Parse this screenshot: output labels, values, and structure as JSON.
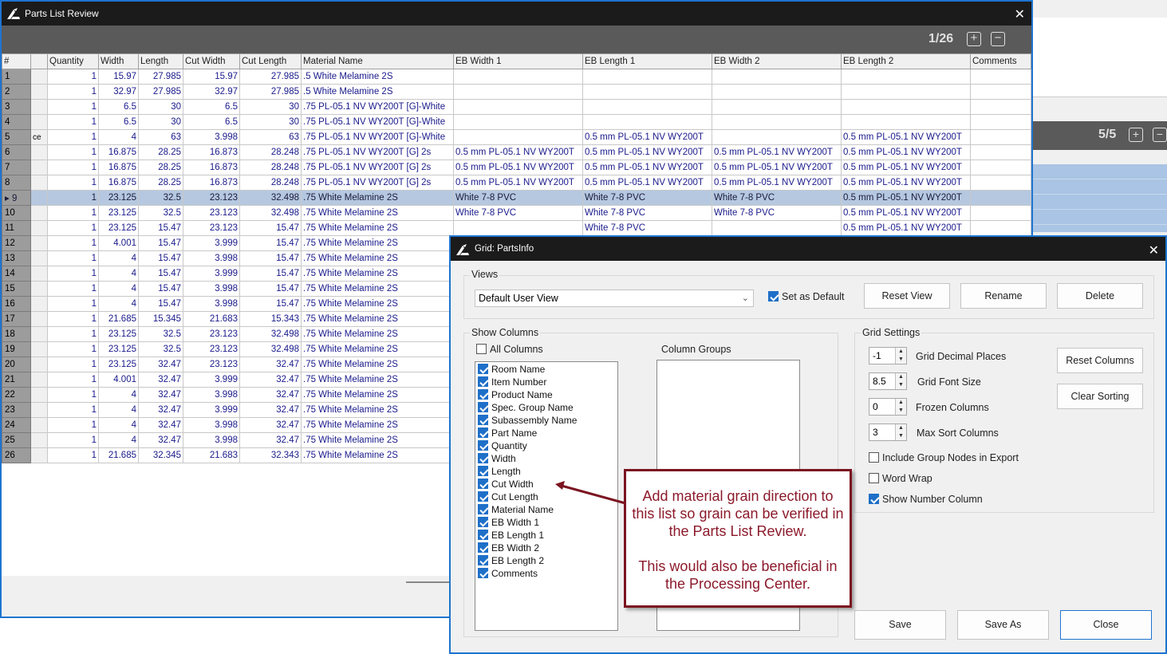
{
  "background_window": {
    "count": "5/5",
    "plus_label": "+",
    "minus_label": "−"
  },
  "parts_list_review": {
    "title": "Parts List Review",
    "close_label": "✕",
    "page_count": "1/26",
    "plus_label": "+",
    "minus_label": "−",
    "columns": [
      "#",
      "",
      "Quantity",
      "Width",
      "Length",
      "Cut Width",
      "Cut Length",
      "Material Name",
      "EB Width 1",
      "EB Length 1",
      "EB Width 2",
      "EB Length 2",
      "Comments"
    ],
    "selected_row": "9",
    "rows": [
      [
        "1",
        "",
        "1",
        "15.97",
        "27.985",
        "15.97",
        "27.985",
        ".5 White Melamine 2S",
        "",
        "",
        "",
        "",
        ""
      ],
      [
        "2",
        "",
        "1",
        "32.97",
        "27.985",
        "32.97",
        "27.985",
        ".5 White Melamine 2S",
        "",
        "",
        "",
        "",
        ""
      ],
      [
        "3",
        "",
        "1",
        "6.5",
        "30",
        "6.5",
        "30",
        ".75 PL-05.1 NV WY200T [G]-White",
        "",
        "",
        "",
        "",
        ""
      ],
      [
        "4",
        "",
        "1",
        "6.5",
        "30",
        "6.5",
        "30",
        ".75 PL-05.1 NV WY200T [G]-White",
        "",
        "",
        "",
        "",
        ""
      ],
      [
        "5",
        "ce",
        "1",
        "4",
        "63",
        "3.998",
        "63",
        ".75 PL-05.1 NV WY200T [G]-White",
        "",
        "0.5 mm PL-05.1 NV WY200T",
        "",
        "0.5 mm PL-05.1 NV WY200T",
        ""
      ],
      [
        "6",
        "",
        "1",
        "16.875",
        "28.25",
        "16.873",
        "28.248",
        ".75 PL-05.1 NV WY200T [G] 2s",
        "0.5 mm PL-05.1 NV WY200T",
        "0.5 mm PL-05.1 NV WY200T",
        "0.5 mm PL-05.1 NV WY200T",
        "0.5 mm PL-05.1 NV WY200T",
        ""
      ],
      [
        "7",
        "",
        "1",
        "16.875",
        "28.25",
        "16.873",
        "28.248",
        ".75 PL-05.1 NV WY200T [G] 2s",
        "0.5 mm PL-05.1 NV WY200T",
        "0.5 mm PL-05.1 NV WY200T",
        "0.5 mm PL-05.1 NV WY200T",
        "0.5 mm PL-05.1 NV WY200T",
        ""
      ],
      [
        "8",
        "",
        "1",
        "16.875",
        "28.25",
        "16.873",
        "28.248",
        ".75 PL-05.1 NV WY200T [G] 2s",
        "0.5 mm PL-05.1 NV WY200T",
        "0.5 mm PL-05.1 NV WY200T",
        "0.5 mm PL-05.1 NV WY200T",
        "0.5 mm PL-05.1 NV WY200T",
        ""
      ],
      [
        "9",
        "",
        "1",
        "23.125",
        "32.5",
        "23.123",
        "32.498",
        ".75 White Melamine 2S",
        "White 7-8 PVC",
        "White 7-8 PVC",
        "White 7-8 PVC",
        "0.5 mm PL-05.1 NV WY200T",
        ""
      ],
      [
        "10",
        "",
        "1",
        "23.125",
        "32.5",
        "23.123",
        "32.498",
        ".75 White Melamine 2S",
        "White 7-8 PVC",
        "White 7-8 PVC",
        "White 7-8 PVC",
        "0.5 mm PL-05.1 NV WY200T",
        ""
      ],
      [
        "11",
        "",
        "1",
        "23.125",
        "15.47",
        "23.123",
        "15.47",
        ".75 White Melamine 2S",
        "",
        "White 7-8 PVC",
        "",
        "0.5 mm PL-05.1 NV WY200T",
        ""
      ],
      [
        "12",
        "",
        "1",
        "4.001",
        "15.47",
        "3.999",
        "15.47",
        ".75 White Melamine 2S",
        "",
        "",
        "",
        "",
        ""
      ],
      [
        "13",
        "",
        "1",
        "4",
        "15.47",
        "3.998",
        "15.47",
        ".75 White Melamine 2S",
        "",
        "",
        "",
        "",
        ""
      ],
      [
        "14",
        "",
        "1",
        "4",
        "15.47",
        "3.999",
        "15.47",
        ".75 White Melamine 2S",
        "",
        "",
        "",
        "",
        ""
      ],
      [
        "15",
        "",
        "1",
        "4",
        "15.47",
        "3.998",
        "15.47",
        ".75 White Melamine 2S",
        "",
        "",
        "",
        "",
        ""
      ],
      [
        "16",
        "",
        "1",
        "4",
        "15.47",
        "3.998",
        "15.47",
        ".75 White Melamine 2S",
        "",
        "",
        "",
        "",
        ""
      ],
      [
        "17",
        "",
        "1",
        "21.685",
        "15.345",
        "21.683",
        "15.343",
        ".75 White Melamine 2S",
        "",
        "",
        "",
        "",
        ""
      ],
      [
        "18",
        "",
        "1",
        "23.125",
        "32.5",
        "23.123",
        "32.498",
        ".75 White Melamine 2S",
        "",
        "",
        "",
        "",
        ""
      ],
      [
        "19",
        "",
        "1",
        "23.125",
        "32.5",
        "23.123",
        "32.498",
        ".75 White Melamine 2S",
        "",
        "",
        "",
        "",
        ""
      ],
      [
        "20",
        "",
        "1",
        "23.125",
        "32.47",
        "23.123",
        "32.47",
        ".75 White Melamine 2S",
        "",
        "",
        "",
        "",
        ""
      ],
      [
        "21",
        "",
        "1",
        "4.001",
        "32.47",
        "3.999",
        "32.47",
        ".75 White Melamine 2S",
        "",
        "",
        "",
        "",
        ""
      ],
      [
        "22",
        "",
        "1",
        "4",
        "32.47",
        "3.998",
        "32.47",
        ".75 White Melamine 2S",
        "",
        "",
        "",
        "",
        ""
      ],
      [
        "23",
        "",
        "1",
        "4",
        "32.47",
        "3.999",
        "32.47",
        ".75 White Melamine 2S",
        "",
        "",
        "",
        "",
        ""
      ],
      [
        "24",
        "",
        "1",
        "4",
        "32.47",
        "3.998",
        "32.47",
        ".75 White Melamine 2S",
        "",
        "",
        "",
        "",
        ""
      ],
      [
        "25",
        "",
        "1",
        "4",
        "32.47",
        "3.998",
        "32.47",
        ".75 White Melamine 2S",
        "",
        "",
        "",
        "",
        ""
      ],
      [
        "26",
        "",
        "1",
        "21.685",
        "32.345",
        "21.683",
        "32.343",
        ".75 White Melamine 2S",
        "",
        "",
        "",
        "",
        ""
      ]
    ]
  },
  "dialog": {
    "title": "Grid: PartsInfo",
    "close_label": "✕",
    "views": {
      "label": "Views",
      "selected_view": "Default User View",
      "set_as_default_label": "Set as Default",
      "set_as_default_checked": true,
      "reset_view": "Reset View",
      "rename": "Rename",
      "delete": "Delete"
    },
    "show_columns": {
      "label": "Show Columns",
      "all_columns_label": "All Columns",
      "all_columns_checked": false,
      "column_groups_label": "Column Groups",
      "items": [
        {
          "label": "Room Name",
          "checked": true
        },
        {
          "label": "Item Number",
          "checked": true
        },
        {
          "label": "Product Name",
          "checked": true
        },
        {
          "label": "Spec. Group Name",
          "checked": true
        },
        {
          "label": "Subassembly Name",
          "checked": true
        },
        {
          "label": "Part Name",
          "checked": true
        },
        {
          "label": "Quantity",
          "checked": true
        },
        {
          "label": "Width",
          "checked": true
        },
        {
          "label": "Length",
          "checked": true
        },
        {
          "label": "Cut Width",
          "checked": true
        },
        {
          "label": "Cut Length",
          "checked": true
        },
        {
          "label": "Material Name",
          "checked": true
        },
        {
          "label": "EB Width 1",
          "checked": true
        },
        {
          "label": "EB Length 1",
          "checked": true
        },
        {
          "label": "EB Width 2",
          "checked": true
        },
        {
          "label": "EB Length 2",
          "checked": true
        },
        {
          "label": "Comments",
          "checked": true
        }
      ]
    },
    "grid_settings": {
      "label": "Grid Settings",
      "decimal_places_value": "-1",
      "decimal_places_label": "Grid Decimal Places",
      "font_size_value": "8.5",
      "font_size_label": "Grid Font Size",
      "frozen_columns_value": "0",
      "frozen_columns_label": "Frozen Columns",
      "max_sort_value": "3",
      "max_sort_label": "Max Sort Columns",
      "reset_columns": "Reset Columns",
      "clear_sorting": "Clear Sorting",
      "include_group_nodes_label": "Include Group Nodes in Export",
      "include_group_nodes_checked": false,
      "word_wrap_label": "Word Wrap",
      "word_wrap_checked": false,
      "show_number_column_label": "Show Number Column",
      "show_number_column_checked": true
    },
    "footer": {
      "save": "Save",
      "save_as": "Save As",
      "close": "Close"
    }
  },
  "callout": {
    "paragraph1": "Add material grain direction to this list so grain can be verified in the Parts List Review.",
    "paragraph2": "This would also be beneficial in the Processing Center.",
    "color": "#8c1a2b",
    "border_color": "#7b1420"
  }
}
